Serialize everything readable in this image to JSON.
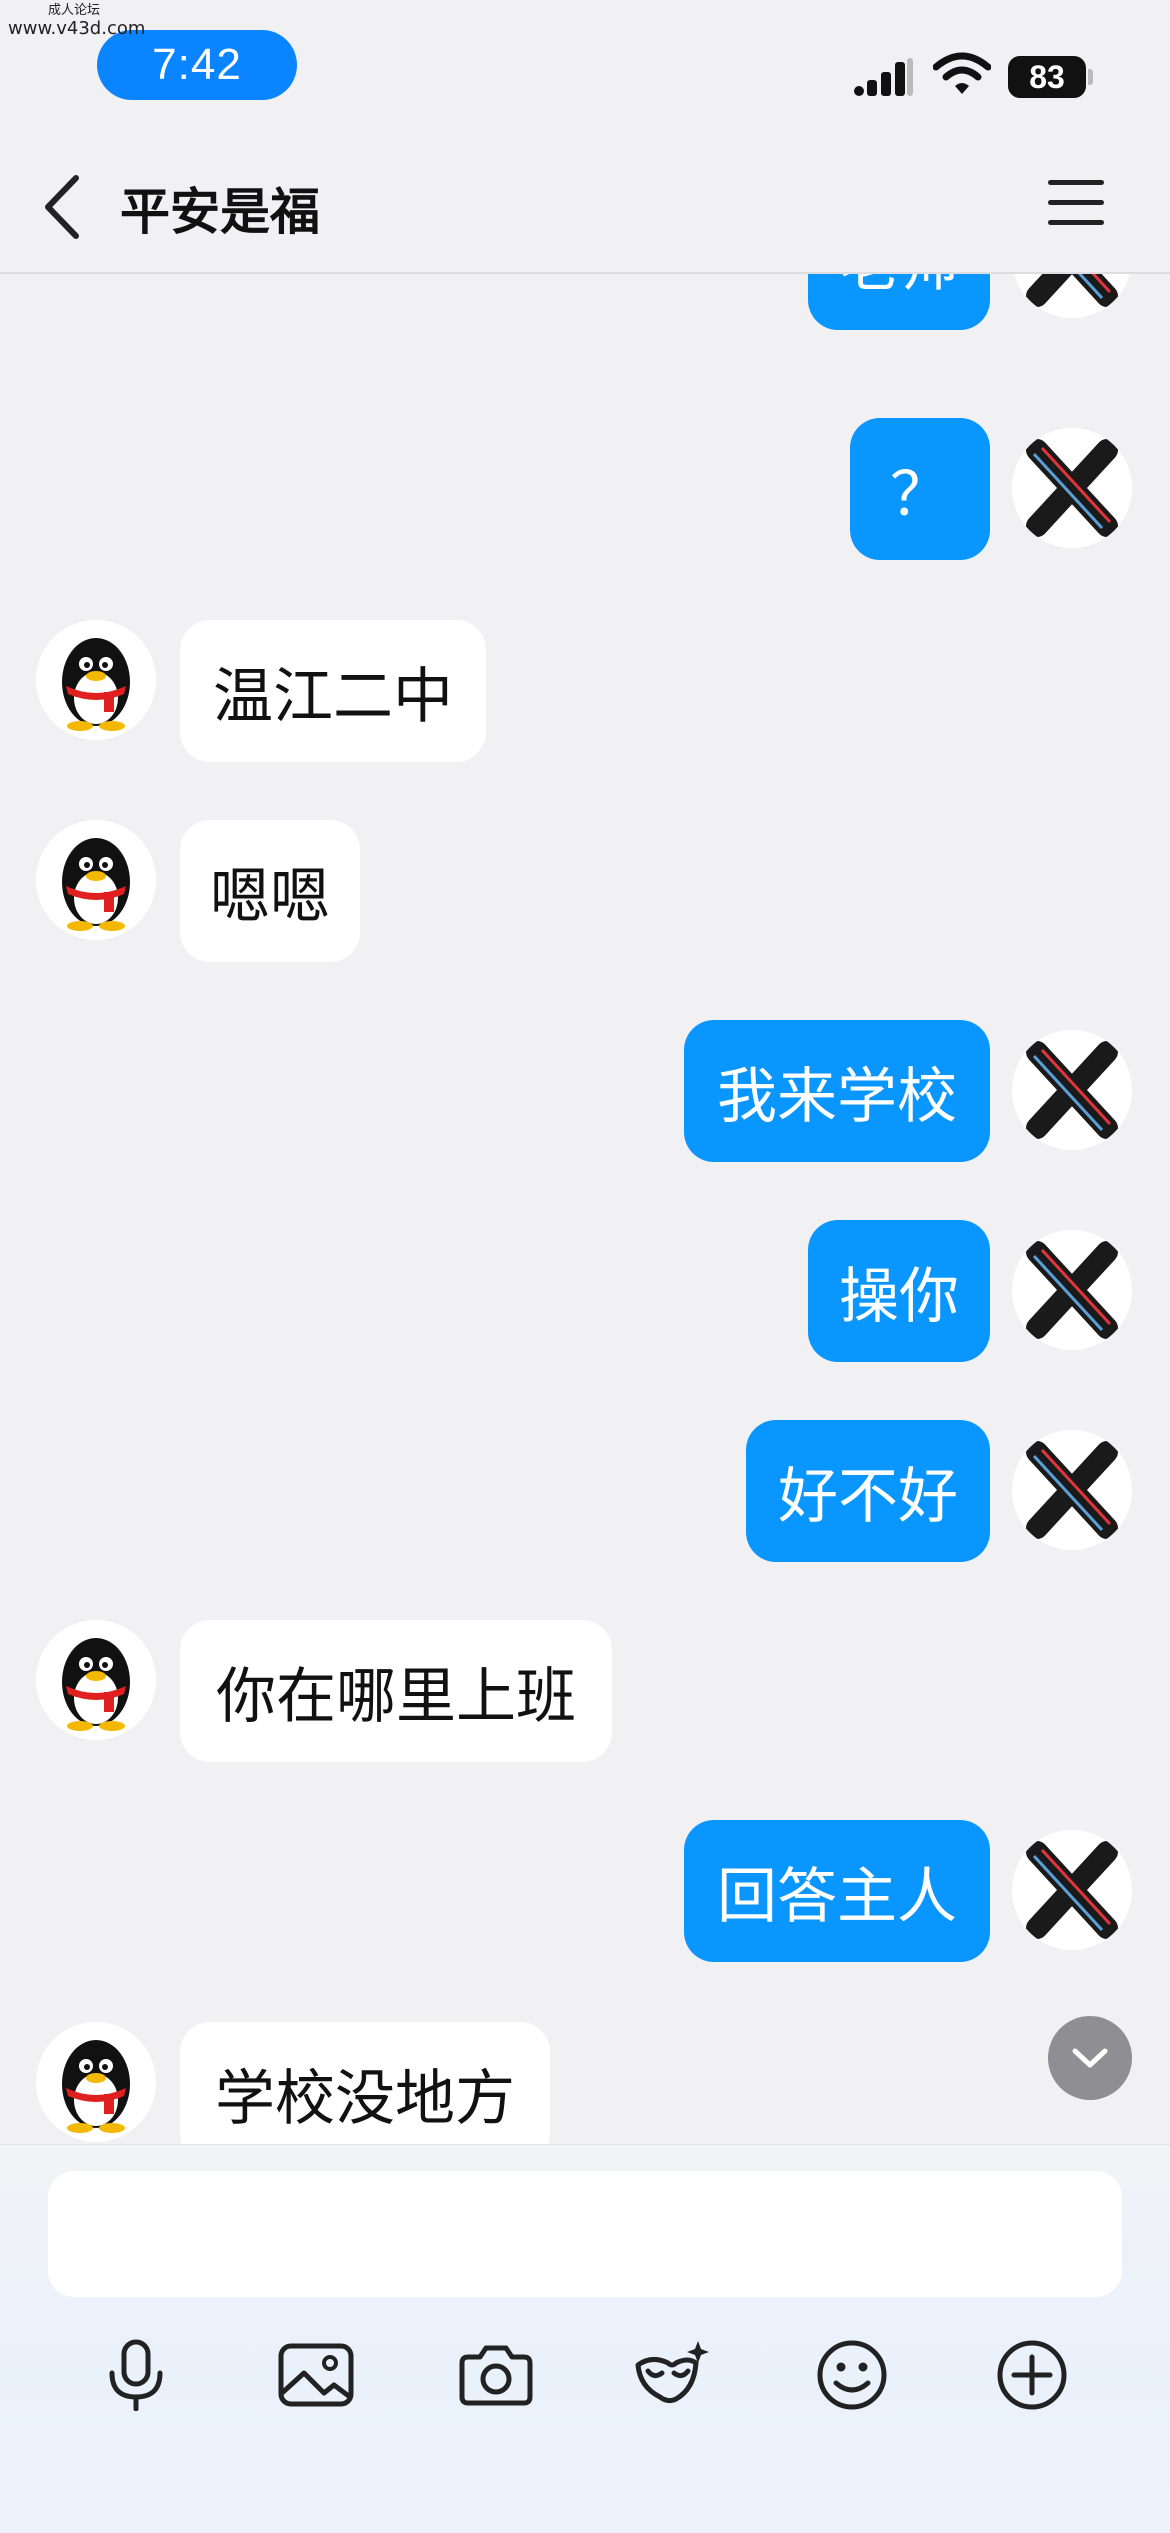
{
  "watermark": {
    "line1": "成人论坛",
    "line2": "www.v43d.com"
  },
  "status": {
    "time": "7:42",
    "battery": "83"
  },
  "header": {
    "title": "平安是福"
  },
  "messages": [
    {
      "side": "out",
      "text": "老师"
    },
    {
      "side": "out",
      "text": "？"
    },
    {
      "side": "in",
      "text": "温江二中"
    },
    {
      "side": "in",
      "text": "嗯嗯"
    },
    {
      "side": "out",
      "text": "我来学校"
    },
    {
      "side": "out",
      "text": "操你"
    },
    {
      "side": "out",
      "text": "好不好"
    },
    {
      "side": "in",
      "text": "你在哪里上班"
    },
    {
      "side": "out",
      "text": "回答主人"
    },
    {
      "side": "in",
      "text": "学校没地方"
    }
  ],
  "input": {
    "value": ""
  },
  "toolbar": [
    "microphone-icon",
    "image-icon",
    "camera-icon",
    "mask-icon",
    "emoji-icon",
    "plus-icon"
  ],
  "colors": {
    "accent": "#0a96ff",
    "time_pill": "#0a84ff",
    "background": "#f1f1f3"
  }
}
